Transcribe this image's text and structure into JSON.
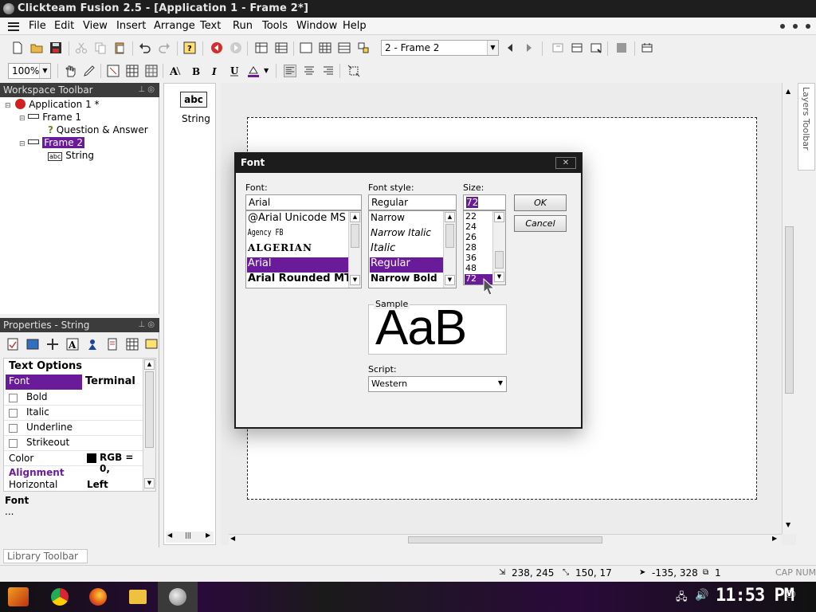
{
  "window": {
    "title": "Clickteam Fusion 2.5 - [Application 1 - Frame 2*]"
  },
  "menu": [
    "File",
    "Edit",
    "View",
    "Insert",
    "Arrange",
    "Text",
    "Run",
    "Tools",
    "Window",
    "Help"
  ],
  "toolbar": {
    "frame_select": "2 - Frame 2",
    "zoom": "100%"
  },
  "workspace": {
    "title": "Workspace Toolbar",
    "tree": [
      {
        "label": "Application 1 *",
        "icon": "app-icon",
        "level": 0
      },
      {
        "label": "Frame 1",
        "icon": "frame-icon",
        "level": 1
      },
      {
        "label": "Question & Answer",
        "icon": "qa-object-icon",
        "level": 2
      },
      {
        "label": "Frame 2",
        "icon": "frame-icon",
        "level": 1,
        "selected": true
      },
      {
        "label": "String",
        "icon": "string-object-icon",
        "level": 2
      }
    ]
  },
  "objects_panel": {
    "item_label": "String",
    "item_icon_text": "abc"
  },
  "properties": {
    "title": "Properties - String",
    "section1": "Text Options",
    "font_label": "Font",
    "font_value": "Terminal",
    "bold": "Bold",
    "italic": "Italic",
    "underline": "Underline",
    "strikeout": "Strikeout",
    "color_label": "Color",
    "color_value": "RGB = 0,",
    "section2": "Alignment",
    "horizontal_label": "Horizontal",
    "horizontal_value": "Left",
    "help_title": "Font",
    "help_text": "..."
  },
  "layers_toolbar": "Layers Toolbar",
  "library_toolbar": "Library Toolbar",
  "status": {
    "pos1": "238, 245",
    "pos2": "150, 17",
    "pos3": "-135, 328",
    "count": "1",
    "keys": "CAP  NUM"
  },
  "font_dialog": {
    "title": "Font",
    "font_label": "Font:",
    "font_value": "Arial",
    "fonts": [
      "@Arial Unicode MS",
      "Agency FB",
      "ALGERIAN",
      "Arial",
      "Arial Rounded MT"
    ],
    "style_label": "Font style:",
    "style_value": "Regular",
    "styles": [
      "Narrow",
      "Narrow Italic",
      "Italic",
      "Regular",
      "Narrow Bold"
    ],
    "size_label": "Size:",
    "size_value": "72",
    "sizes": [
      "22",
      "24",
      "26",
      "28",
      "36",
      "48",
      "72"
    ],
    "ok": "OK",
    "cancel": "Cancel",
    "sample_label": "Sample",
    "sample_text": "AaB",
    "script_label": "Script:",
    "script_value": "Western"
  },
  "taskbar": {
    "clock": "11:53 PM"
  },
  "colors": {
    "accent": "#6a1b9a",
    "titlebar": "#1e1e1e",
    "panel_head": "#3c3c3c"
  }
}
